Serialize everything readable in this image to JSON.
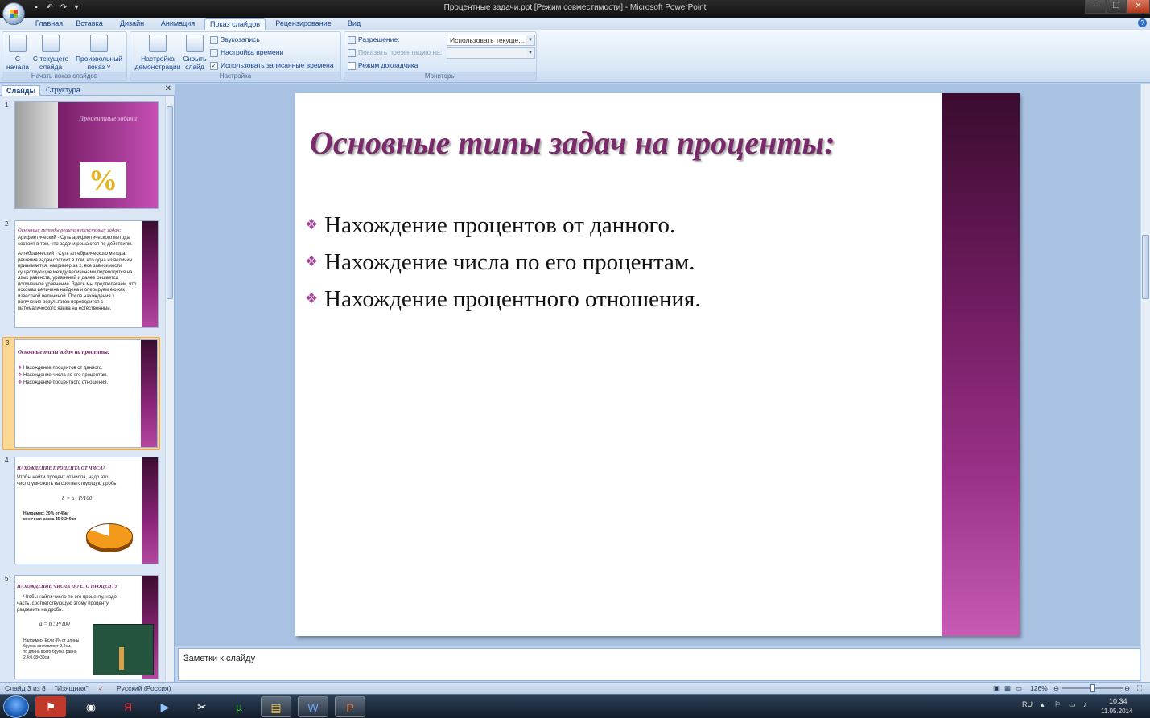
{
  "window": {
    "title": "Процентные задачи.ppt [Режим совместимости] - Microsoft PowerPoint",
    "controls": [
      "‒",
      "❐",
      "✕"
    ]
  },
  "tabs": [
    "Главная",
    "Вставка",
    "Дизайн",
    "Анимация",
    "Показ слайдов",
    "Рецензирование",
    "Вид"
  ],
  "active_tab": "Показ слайдов",
  "ribbon": {
    "start_group": {
      "label": "Начать показ слайдов",
      "from_start": [
        "С",
        "начала"
      ],
      "from_current": [
        "С текущего",
        "слайда"
      ],
      "custom": [
        "Произвольный",
        "показ ˅"
      ]
    },
    "setup_group": {
      "label": "Настройка",
      "setup_show": [
        "Настройка",
        "демонстрации"
      ],
      "hide_slide": [
        "Скрыть",
        "слайд"
      ],
      "record": "Звукозапись",
      "timing": "Настройка времени",
      "use_timings": "Использовать записанные времена"
    },
    "monitors_group": {
      "label": "Мониторы",
      "resolution_label": "Разрешение:",
      "resolution_value": "Использовать текуще...",
      "show_on_label": "Показать презентацию на:",
      "show_on_value": "",
      "presenter_view": "Режим докладчика"
    }
  },
  "left_pane": {
    "tabs": [
      "Слайды",
      "Структура"
    ],
    "close": "✕",
    "slides": [
      {
        "num": "1",
        "title": "Процентные задачи"
      },
      {
        "num": "2",
        "title": "Основные методы решения текстовых задач:",
        "lines": [
          "Арифметический - Суть арифметического метода состоит в том, что задачи решаются по действиям.",
          "Алгебраический - Суть алгебраического метода решения задач состоит в том, что одна из величин принимается, например за x, все зависимости существующие между величинами переводятся на язык равенств, уравнений и далее решается полученное уравнение. Здесь мы предполагаем, что искомая величина найдена и оперируем ею как известной величиной. После нахождения x получение результатов переводится с математического языка на естественный."
        ]
      },
      {
        "num": "3",
        "title": "Основные типы задач на проценты:",
        "lines": [
          "Нахождение процентов от данного.",
          "Нахождение числа по его процентам.",
          "Нахождение процентного отношения."
        ]
      },
      {
        "num": "4",
        "title": "НАХОЖДЕНИЕ ПРОЦЕНТА ОТ ЧИСЛА",
        "lines": [
          "Чтобы найти процент от числа, надо это",
          "число умножить на соответствующую дробь"
        ],
        "formula": "b = a · P/100",
        "example": [
          "Например: 20% от 45кг",
          "конечная разна 45·0,2=9 кг"
        ]
      },
      {
        "num": "5",
        "title": "НАХОЖДЕНИЕ ЧИСЛА ПО ЕГО ПРОЦЕНТУ",
        "lines": [
          "Чтобы найти число по его проценту, надо",
          "часть, соответствующую этому проценту",
          "разделить на дробь."
        ],
        "formula": "a = b : P/100",
        "example": [
          "Например: Если 8% от длины",
          "бруска составляют 2,4см,",
          "то длина всего бруска равна",
          "2,4:0,08=30см"
        ]
      }
    ]
  },
  "slide": {
    "title": "Основные типы задач на проценты:",
    "bullets": [
      "Нахождение процентов от данного.",
      "Нахождение числа по его процентам.",
      "Нахождение процентного отношения."
    ],
    "bullet_mark": "❖"
  },
  "notes_placeholder": "Заметки к слайду",
  "status": {
    "slide_of": "Слайд 3 из 8",
    "theme": "\"Изящная\"",
    "language": "Русский (Россия)",
    "zoom": "126%"
  },
  "taskbar": {
    "lang": "RU",
    "time": "10:34",
    "date": "11.05.2014"
  },
  "colors": {
    "accent": "#7a2a6a",
    "stripe": "#6b1a5b",
    "selection": "#fbd893"
  }
}
